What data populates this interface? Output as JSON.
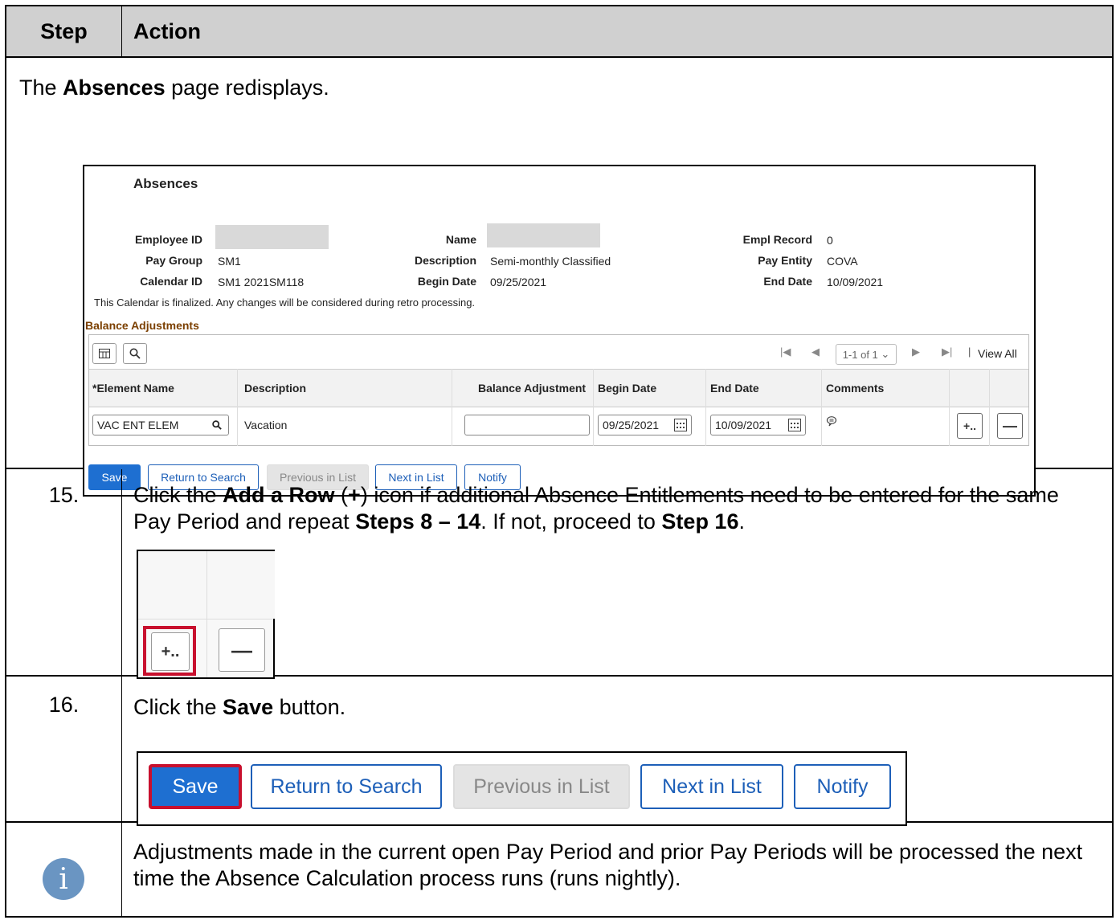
{
  "header": {
    "step": "Step",
    "action": "Action"
  },
  "intro": {
    "pre": "The ",
    "bold": "Absences",
    "post": " page redisplays."
  },
  "absences": {
    "title": "Absences",
    "employee_id_label": "Employee ID",
    "name_label": "Name",
    "empl_record_label": "Empl Record",
    "empl_record_value": "0",
    "pay_group_label": "Pay Group",
    "pay_group_value": "SM1",
    "description_label": "Description",
    "description_value": "Semi-monthly Classified",
    "pay_entity_label": "Pay Entity",
    "pay_entity_value": "COVA",
    "calendar_id_label": "Calendar ID",
    "calendar_id_value": "SM1 2021SM118",
    "begin_date_label": "Begin Date",
    "begin_date_value": "09/25/2021",
    "end_date_label": "End Date",
    "end_date_value": "10/09/2021",
    "note": "This Calendar is finalized. Any changes will be considered during retro processing.",
    "balance_heading": "Balance Adjustments",
    "pagination": "1-1 of 1",
    "view_all": "View All",
    "columns": {
      "element_name": "*Element Name",
      "description": "Description",
      "balance_adjustment": "Balance Adjustment",
      "begin_date": "Begin Date",
      "end_date": "End Date",
      "comments": "Comments"
    },
    "row": {
      "element_name": "VAC ENT ELEM",
      "description": "Vacation",
      "balance_adjustment": "",
      "begin_date": "09/25/2021",
      "end_date": "10/09/2021"
    },
    "add_label": "+..",
    "delete_label": "—",
    "buttons": {
      "save": "Save",
      "return": "Return to Search",
      "previous": "Previous in List",
      "next": "Next in List",
      "notify": "Notify"
    }
  },
  "step15": {
    "number": "15.",
    "t1": "Click the ",
    "b1": "Add a Row",
    "t2": " (",
    "b2": "+",
    "t3": ") icon if additional Absence Entitlements need to be entered for the same Pay Period and repeat ",
    "b3": "Steps 8 – 14",
    "t4": ". If not, proceed to ",
    "b4": "Step 16",
    "t5": "."
  },
  "step16": {
    "number": "16.",
    "t1": "Click the ",
    "b1": "Save",
    "t2": " button."
  },
  "info": {
    "icon": "i",
    "text": "Adjustments made in the current open Pay Period and prior Pay Periods will be processed the next time the Absence Calculation process runs (runs nightly)."
  }
}
